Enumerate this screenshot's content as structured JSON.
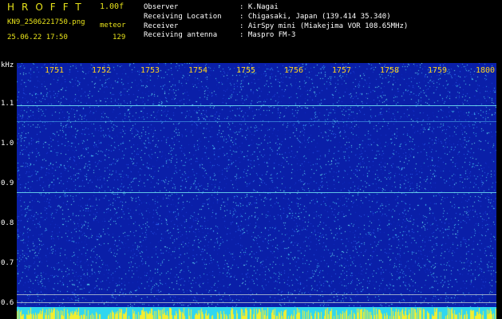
{
  "header": {
    "app_title": "HROFFT",
    "version": "1.00f",
    "filename": "KN9_2506221750.png",
    "meteor_label": "meteor",
    "datetime": "25.06.22 17:50",
    "count": "129",
    "info": [
      {
        "label": "Observer",
        "value": ": K.Nagai"
      },
      {
        "label": "Receiving Location",
        "value": ": Chigasaki, Japan (139.414 35.340)"
      },
      {
        "label": "Receiver",
        "value": ": AirSpy mini (Miakejima VOR 108.65MHz)"
      },
      {
        "label": "Receiving antenna",
        "value": ": Maspro FM-3"
      }
    ]
  },
  "axis": {
    "unit": "kHz",
    "y_labels": [
      "1.1",
      "1.0",
      "0.9",
      "0.8",
      "0.7",
      "0.6"
    ],
    "time_labels": [
      "1751",
      "1752",
      "1753",
      "1754",
      "1755",
      "1756",
      "1757",
      "1758",
      "1759",
      "1800"
    ]
  },
  "colors": {
    "background": "#0a1fa8",
    "text_yellow": "#e7e21a",
    "line_cyan": "#6fe0f0",
    "strip_yellow": "#f2ee30",
    "strip_cyan": "#2fd6f0"
  }
}
